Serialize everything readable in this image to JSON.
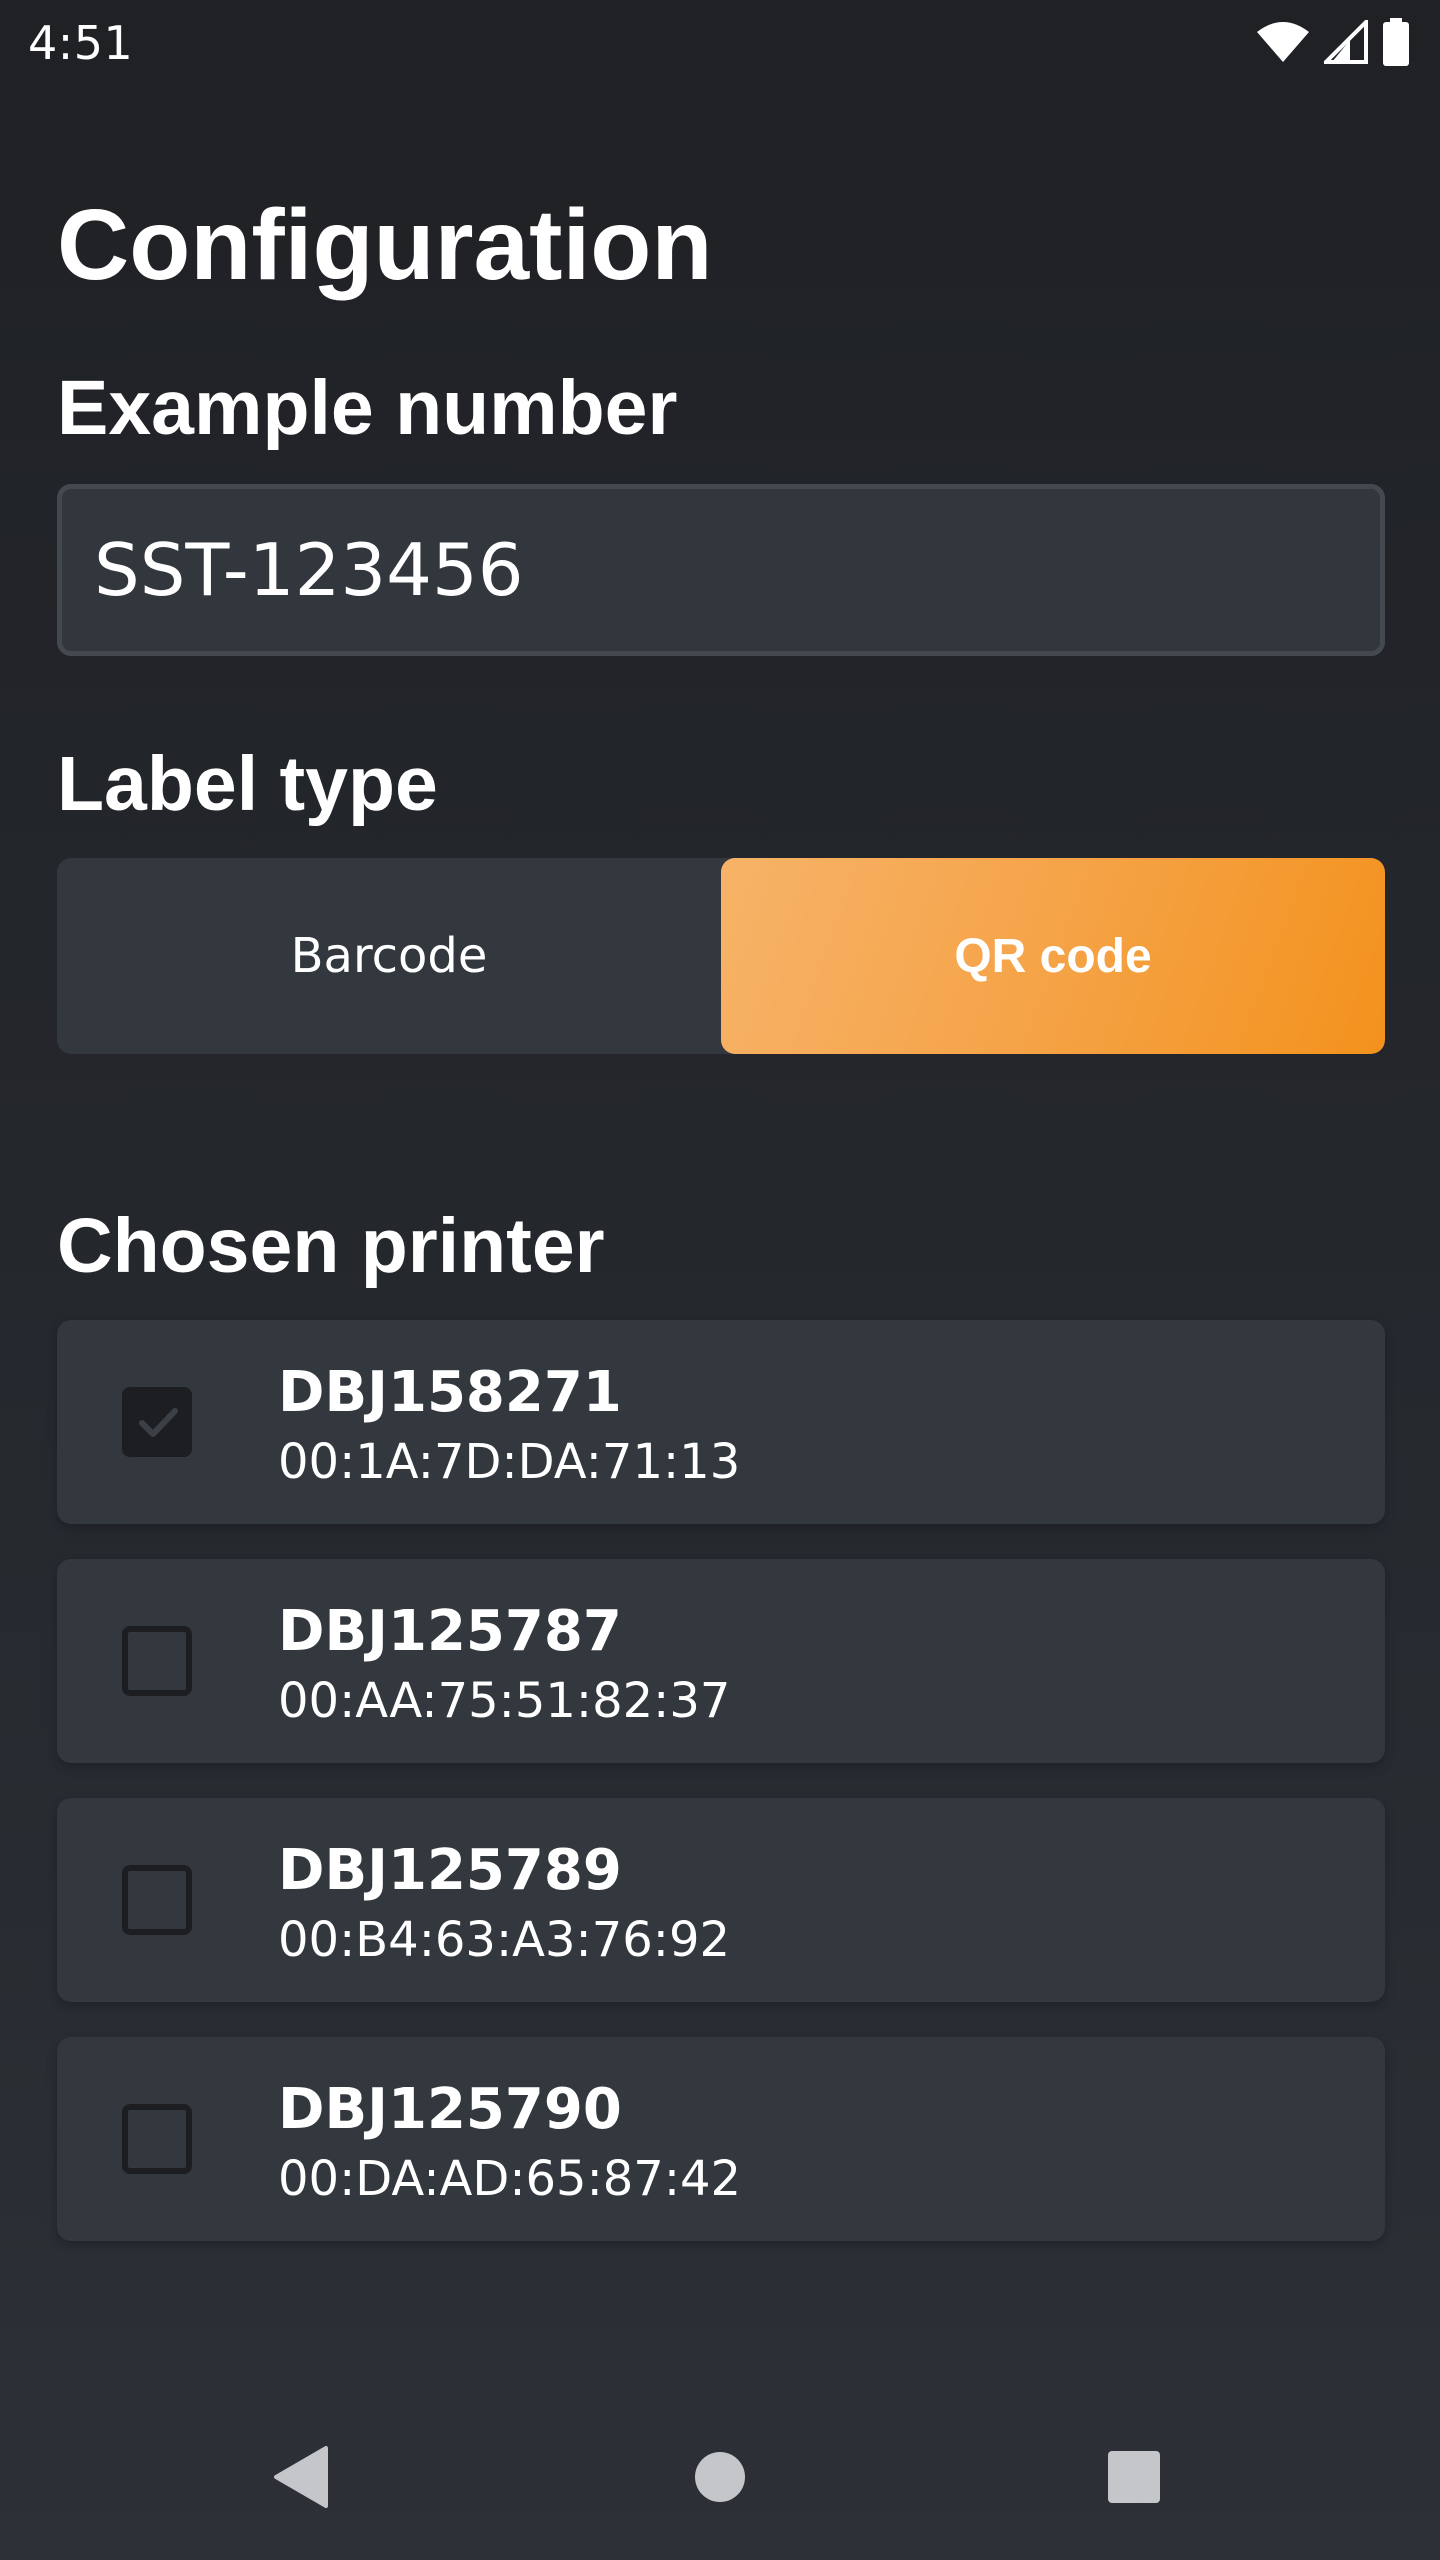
{
  "status_bar": {
    "time": "4:51",
    "icons": [
      "wifi-icon",
      "signal-icon",
      "battery-icon"
    ]
  },
  "page": {
    "title": "Configuration"
  },
  "example_number": {
    "heading": "Example number",
    "value": "SST-123456"
  },
  "label_type": {
    "heading": "Label type",
    "options": [
      "Barcode",
      "QR code"
    ],
    "selected": "QR code"
  },
  "printers": {
    "heading": "Chosen printer",
    "items": [
      {
        "name": "DBJ158271",
        "mac": "00:1A:7D:DA:71:13",
        "checked": true
      },
      {
        "name": "DBJ125787",
        "mac": "00:AA:75:51:82:37",
        "checked": false
      },
      {
        "name": "DBJ125789",
        "mac": "00:B4:63:A3:76:92",
        "checked": false
      },
      {
        "name": "DBJ125790",
        "mac": "00:DA:AD:65:87:42",
        "checked": false
      }
    ]
  },
  "nav": {
    "buttons": [
      "back-icon",
      "home-icon",
      "recents-icon"
    ]
  },
  "colors": {
    "accent_start": "#f7b368",
    "accent_end": "#f3921d",
    "card": "#33383e",
    "background": "#1f2125"
  }
}
